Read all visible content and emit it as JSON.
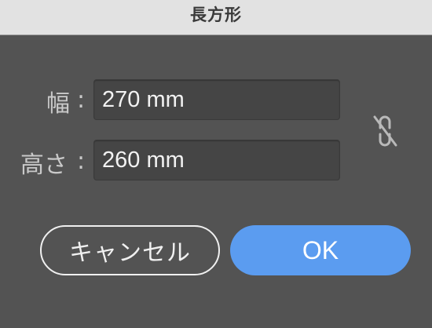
{
  "dialog": {
    "title": "長方形"
  },
  "fields": {
    "width": {
      "label": "幅",
      "colon": ":",
      "value": "270 mm"
    },
    "height": {
      "label": "高さ",
      "colon": ":",
      "value": "260 mm"
    }
  },
  "link_toggle": {
    "icon": "broken-link-icon",
    "state": "unlinked"
  },
  "buttons": {
    "cancel_label": "キャンセル",
    "ok_label": "OK"
  },
  "colors": {
    "background": "#535353",
    "titlebar": "#e2e2e2",
    "input_background": "#454545",
    "ok_button": "#5b9cf0",
    "label_text": "#c9c9c9"
  }
}
